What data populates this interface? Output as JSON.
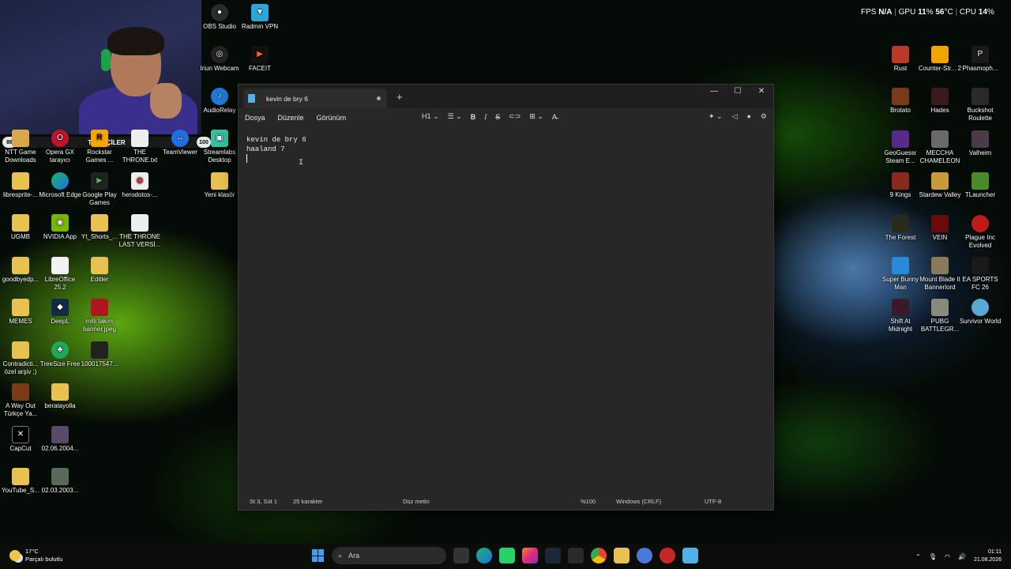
{
  "perf": {
    "fps_label": "FPS",
    "fps_value": "N/A",
    "gpu_label": "GPU",
    "gpu_usage": "11",
    "gpu_usage_unit": "%",
    "gpu_temp": "56",
    "gpu_temp_unit": "°C",
    "cpu_label": "CPU",
    "cpu_usage": "14",
    "cpu_usage_unit": "%"
  },
  "followers": {
    "left_value": "86",
    "label": "TAKİPÇİLER",
    "right_value": "100"
  },
  "desktop_icons": {
    "obs": "OBS Studio",
    "radmin": "Radmin VPN",
    "iriun": "Iriun Webcam",
    "faceit": "FACEIT",
    "audiorelay": "AudioRelay",
    "ntt": "NTT Game Downloads",
    "opera": "Opera GX tarayıcı",
    "rockstar": "Rockstar Games ...",
    "throne_txt": "THE THRONE.txt",
    "teamviewer": "TeamViewer",
    "streamlabs": "Streamlabs Desktop",
    "libresprite": "libresprite-...",
    "edge": "Microsoft Edge",
    "googleplay": "Google Play Games",
    "herodotos": "herodotos-...",
    "yeniklasor": "Yeni klasör",
    "ugmb": "UGMB",
    "nvidia": "NVIDIA App",
    "ytshorts": "Yt_Shorts_...",
    "throne_last": "THE THRONE LAST VERSİ...",
    "goodbye": "goodbyedp...",
    "libreoffice": "LibreOffice 25.2",
    "editler": "Editler",
    "memes": "MEMES",
    "deepl": "DeepL",
    "milli": "milli takım banner.jpeg",
    "contradicti": "Contradicti... özel arşiv ;)",
    "treesize": "TreeSize Free",
    "num": "100017547...",
    "awayout": "A Way Out Türkçe Ya...",
    "beratayolla": "beratayolla",
    "capcut": "CapCut",
    "date1": "02.06.2004...",
    "youtube": "YouTube_S...",
    "date2": "02.03.2003...",
    "rust": "Rust",
    "counterstrike": "Counter-Str... 2",
    "phasmo": "Phasmoph...",
    "brotato": "Brotato",
    "hades": "Hades",
    "buckshot": "Buckshot Roulette",
    "geoguessr": "GeoGuessr Steam E...",
    "meccha": "MECCHA CHAMELEON",
    "valheim": "Valheim",
    "nine_kings": "9 Kings",
    "stardew": "Stardew Valley",
    "tlauncher": "TLauncher",
    "forest": "The Forest",
    "vein": "VEIN",
    "plague": "Plague Inc Evolved",
    "superbunny": "Super Bunny Man",
    "mountblade": "Mount Blade II Bannerlord",
    "easports": "EA SPORTS FC 26",
    "shiftat": "Shift At Midnight",
    "pubg": "PUBG BATTLEGR...",
    "survivor": "Survivor World"
  },
  "notepad": {
    "tab_title": "kevin de bry 6",
    "new_tab": "+",
    "menu": {
      "file": "Dosya",
      "edit": "Düzenle",
      "view": "Görünüm"
    },
    "heading_select": "H1",
    "lines": [
      "kevin de bry 6",
      "haaland 7"
    ],
    "status": {
      "position": "St 3, Süt 1",
      "chars": "25 karakter",
      "format": "Düz metin",
      "zoom": "%100",
      "line_ending": "Windows (CRLF)",
      "encoding": "UTF-8"
    }
  },
  "taskbar": {
    "weather_temp": "17°C",
    "weather_desc": "Parçalı bulutlu",
    "search_placeholder": "Ara",
    "time": "01:11",
    "date": "21.08.2026"
  }
}
